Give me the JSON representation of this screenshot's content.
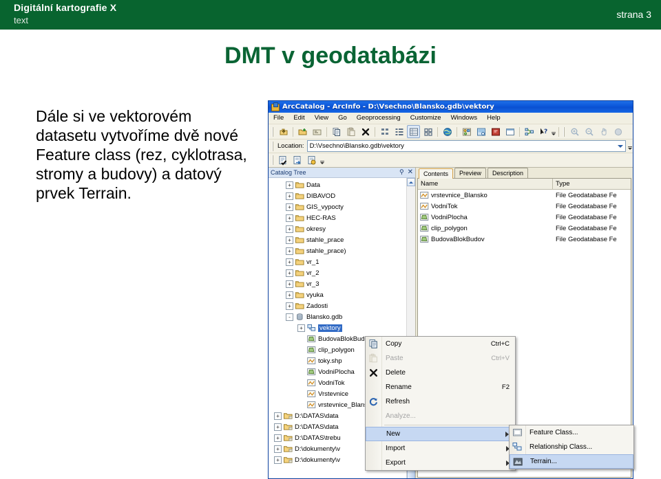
{
  "slide": {
    "header": {
      "title": "Digitální kartografie X",
      "subtitle": "text",
      "page": "strana 3"
    },
    "title": "DMT v geodatabázi",
    "body": "Dále si ve vektorovém datasetu vytvoříme dvě nové Feature class (rez, cyklotrasa, stromy a budovy) a datový prvek Terrain.",
    "accent_green": "#08642f",
    "title_green": "#0a6434"
  },
  "app": {
    "titlebar": {
      "text": "ArcCatalog - ArcInfo - D:\\Vsechno\\Blansko.gdb\\vektory",
      "icon": "arccatalog-icon",
      "color": "#0a54d8"
    },
    "menubar": [
      "File",
      "Edit",
      "View",
      "Go",
      "Geoprocessing",
      "Customize",
      "Windows",
      "Help"
    ],
    "toolbar": [
      {
        "name": "up-one-level-icon"
      },
      {
        "name": "connect-to-folder-icon"
      },
      {
        "name": "disconnect-folder-icon"
      },
      {
        "name": "copy-icon"
      },
      {
        "name": "paste-icon"
      },
      {
        "name": "delete-icon"
      },
      {
        "name": "large-icons-view-icon"
      },
      {
        "name": "list-view-icon"
      },
      {
        "name": "details-view-icon"
      },
      {
        "name": "thumbnails-view-icon"
      },
      {
        "name": "arcglobe-icon"
      },
      {
        "name": "arctoolbox-icon"
      },
      {
        "name": "model-builder-icon"
      },
      {
        "name": "python-window-icon"
      },
      {
        "name": "catalog-window-icon"
      },
      {
        "name": "search-window-icon"
      },
      {
        "name": "whats-this-help-icon"
      }
    ],
    "toolbar_right": [
      {
        "name": "zoom-in-icon"
      },
      {
        "name": "zoom-out-icon"
      },
      {
        "name": "pan-icon"
      },
      {
        "name": "full-extent-icon"
      }
    ],
    "location": {
      "label": "Location:",
      "value": "D:\\Vsechno\\Blansko.gdb\\vektory"
    },
    "toolbar2": [
      {
        "name": "metadata-edit-icon"
      },
      {
        "name": "metadata-import-icon"
      },
      {
        "name": "metadata-export-icon"
      }
    ],
    "catalog_tree": {
      "title": "Catalog Tree",
      "pin_icon": "pin-icon",
      "close_icon": "close-icon",
      "nodes": [
        {
          "label": "Data",
          "icon": "folder-icon",
          "expander": "+",
          "indent": 1
        },
        {
          "label": "DIBAVOD",
          "icon": "folder-icon",
          "expander": "+",
          "indent": 1
        },
        {
          "label": "GIS_vypocty",
          "icon": "folder-icon",
          "expander": "+",
          "indent": 1
        },
        {
          "label": "HEC-RAS",
          "icon": "folder-icon",
          "expander": "+",
          "indent": 1
        },
        {
          "label": "okresy",
          "icon": "folder-icon",
          "expander": "+",
          "indent": 1
        },
        {
          "label": "stahle_prace",
          "icon": "folder-icon",
          "expander": "+",
          "indent": 1
        },
        {
          "label": "stahle_prace)",
          "icon": "folder-icon",
          "expander": "+",
          "indent": 1
        },
        {
          "label": "vr_1",
          "icon": "folder-icon",
          "expander": "+",
          "indent": 1
        },
        {
          "label": "vr_2",
          "icon": "folder-icon",
          "expander": "+",
          "indent": 1
        },
        {
          "label": "vr_3",
          "icon": "folder-icon",
          "expander": "+",
          "indent": 1
        },
        {
          "label": "vyuka",
          "icon": "folder-icon",
          "expander": "+",
          "indent": 1
        },
        {
          "label": "Zadosti",
          "icon": "folder-icon",
          "expander": "+",
          "indent": 1
        },
        {
          "label": "Blansko.gdb",
          "icon": "geodatabase-icon",
          "expander": "-",
          "indent": 1
        },
        {
          "label": "vektory",
          "icon": "feature-dataset-icon",
          "expander": "+",
          "indent": 2,
          "selected": true
        },
        {
          "label": "BudovaBlokBudov",
          "icon": "polygon-feature-icon",
          "expander": "",
          "indent": 2
        },
        {
          "label": "clip_polygon",
          "icon": "polygon-feature-icon",
          "expander": "",
          "indent": 2
        },
        {
          "label": "toky.shp",
          "icon": "line-feature-icon",
          "expander": "",
          "indent": 2
        },
        {
          "label": "VodniPlocha",
          "icon": "polygon-feature-icon",
          "expander": "",
          "indent": 2
        },
        {
          "label": "VodniTok",
          "icon": "line-feature-icon",
          "expander": "",
          "indent": 2
        },
        {
          "label": "Vrstevnice",
          "icon": "line-feature-icon",
          "expander": "",
          "indent": 2
        },
        {
          "label": "vrstevnice_Blansko",
          "icon": "line-feature-icon",
          "expander": "",
          "indent": 2
        },
        {
          "label": "D:\\DATAS\\data",
          "icon": "folder-connection-icon",
          "expander": "+",
          "indent": 0
        },
        {
          "label": "D:\\DATAS\\data",
          "icon": "folder-connection-icon",
          "expander": "+",
          "indent": 0
        },
        {
          "label": "D:\\DATAS\\trebu",
          "icon": "folder-connection-icon",
          "expander": "+",
          "indent": 0
        },
        {
          "label": "D:\\dokumenty\\v",
          "icon": "folder-connection-icon",
          "expander": "+",
          "indent": 0
        },
        {
          "label": "D:\\dokumenty\\v",
          "icon": "folder-connection-icon",
          "expander": "+",
          "indent": 0
        }
      ]
    },
    "tabs": [
      {
        "label": "Contents",
        "active": true
      },
      {
        "label": "Preview",
        "active": false
      },
      {
        "label": "Description",
        "active": false
      }
    ],
    "contents_grid": {
      "columns": [
        "Name",
        "Type"
      ],
      "rows": [
        {
          "name": "vrstevnice_Blansko",
          "type": "File Geodatabase Fe",
          "icon": "line-feature-icon"
        },
        {
          "name": "VodniTok",
          "type": "File Geodatabase Fe",
          "icon": "line-feature-icon"
        },
        {
          "name": "VodniPlocha",
          "type": "File Geodatabase Fe",
          "icon": "polygon-feature-icon"
        },
        {
          "name": "clip_polygon",
          "type": "File Geodatabase Fe",
          "icon": "polygon-feature-icon"
        },
        {
          "name": "BudovaBlokBudov",
          "type": "File Geodatabase Fe",
          "icon": "polygon-feature-icon"
        }
      ]
    },
    "context_menu": {
      "items": [
        {
          "label": "Copy",
          "shortcut": "Ctrl+C",
          "icon": "copy-icon",
          "disabled": false,
          "submenu": false,
          "selected": false
        },
        {
          "label": "Paste",
          "shortcut": "Ctrl+V",
          "icon": "paste-icon",
          "disabled": true,
          "submenu": false,
          "selected": false
        },
        {
          "label": "Delete",
          "shortcut": "",
          "icon": "delete-x-icon",
          "disabled": false,
          "submenu": false,
          "selected": false
        },
        {
          "label": "Rename",
          "shortcut": "F2",
          "icon": "",
          "disabled": false,
          "submenu": false,
          "selected": false
        },
        {
          "label": "Refresh",
          "shortcut": "",
          "icon": "refresh-icon",
          "disabled": false,
          "submenu": false,
          "selected": false
        },
        {
          "label": "Analyze...",
          "shortcut": "",
          "icon": "",
          "disabled": true,
          "submenu": false,
          "selected": false
        },
        {
          "label": "New",
          "shortcut": "",
          "icon": "",
          "disabled": false,
          "submenu": true,
          "selected": true
        },
        {
          "label": "Import",
          "shortcut": "",
          "icon": "",
          "disabled": false,
          "submenu": true,
          "selected": false
        },
        {
          "label": "Export",
          "shortcut": "",
          "icon": "",
          "disabled": false,
          "submenu": true,
          "selected": false
        }
      ],
      "separator_after": [
        5
      ]
    },
    "submenu": {
      "items": [
        {
          "label": "Feature Class...",
          "icon": "feature-class-icon",
          "selected": false
        },
        {
          "label": "Relationship Class...",
          "icon": "relationship-class-icon",
          "selected": false
        },
        {
          "label": "Terrain...",
          "icon": "terrain-icon",
          "selected": true
        }
      ]
    }
  }
}
